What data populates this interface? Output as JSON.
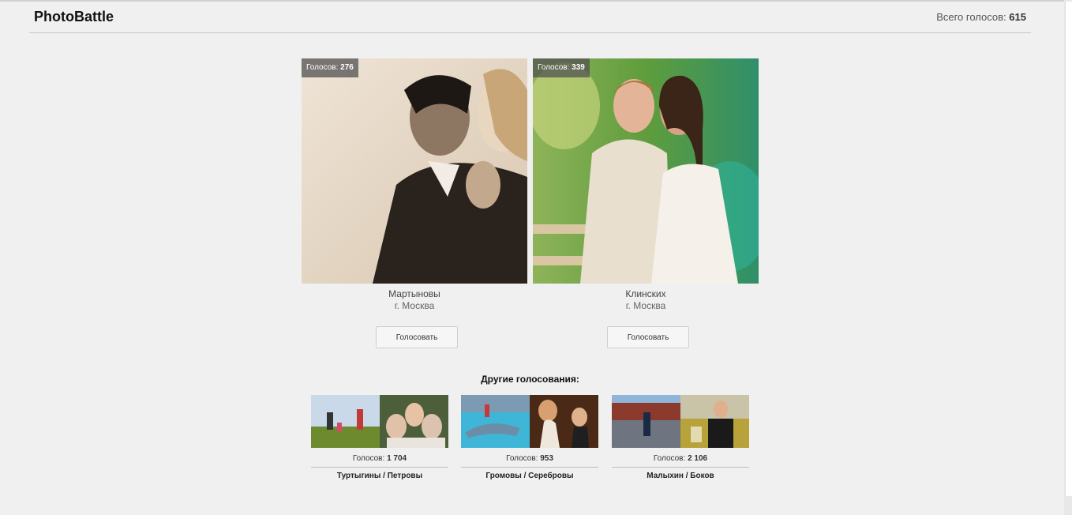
{
  "header": {
    "logo": "PhotoBattle",
    "total_label": "Всего голосов:",
    "total_value": "615"
  },
  "battle": {
    "left": {
      "votes_label": "Голосов:",
      "votes": "276",
      "name": "Мартыновы",
      "city": "г. Москва",
      "vote_button": "Голосовать"
    },
    "right": {
      "votes_label": "Голосов:",
      "votes": "339",
      "name": "Клинских",
      "city": "г. Москва",
      "vote_button": "Голосовать"
    }
  },
  "others": {
    "title": "Другие голосования:",
    "items": [
      {
        "votes_label": "Голосов:",
        "votes": "1 704",
        "names": "Туртыгины / Петровы"
      },
      {
        "votes_label": "Голосов:",
        "votes": "953",
        "names": "Громовы / Серебровы"
      },
      {
        "votes_label": "Голосов:",
        "votes": "2 106",
        "names": "Малыхин / Боков"
      }
    ]
  }
}
